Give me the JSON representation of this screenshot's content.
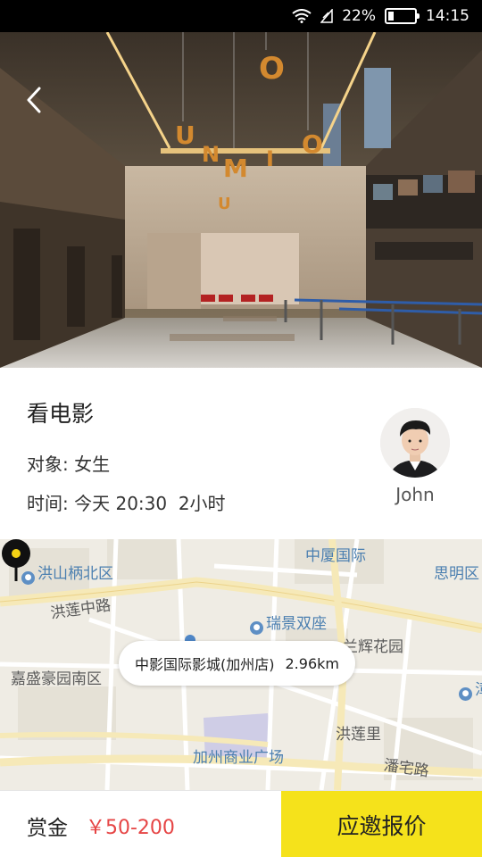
{
  "status_bar": {
    "battery": "22%",
    "battery_level": 0.22,
    "time": "14:15"
  },
  "hero": {
    "image": "cinema-lobby-photo",
    "back_icon": "chevron-left-icon"
  },
  "event": {
    "title": "看电影",
    "target_label": "对象:",
    "target_value": "女生",
    "time_label": "时间:",
    "time_value": "今天 20:30  2小时"
  },
  "host": {
    "name": "John",
    "avatar_icon": "user-avatar"
  },
  "map": {
    "callout": {
      "place": "中影国际影城(加州店)",
      "distance": "2.96km"
    },
    "labels": {
      "hongshan": "洪山柄北区",
      "zhongxia": "中厦国际",
      "siming": "思明区",
      "honglian_road": "洪莲中路",
      "ruijing": "瑞景双座",
      "huihui": "兰辉花园",
      "jiasheng": "嘉盛豪园南区",
      "jiazhou": "加州商业广场",
      "honglianli": "洪莲里",
      "panzhai": "潘宅路",
      "edge": "漳"
    },
    "pin_icon": "map-pin-icon"
  },
  "footer": {
    "reward_label": "赏金",
    "reward_value": "￥50-200",
    "cta_label": "应邀报价"
  },
  "colors": {
    "accent": "#f5e21b",
    "price": "#e64545"
  }
}
